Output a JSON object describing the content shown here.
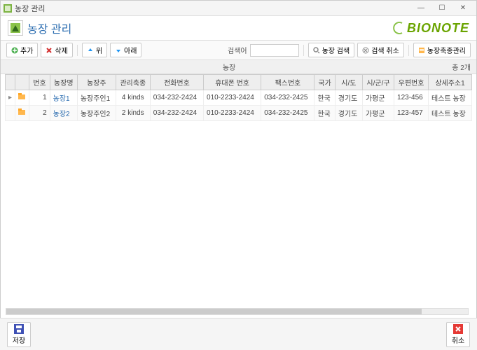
{
  "window": {
    "title": "농장 관리"
  },
  "header": {
    "title": "농장 관리",
    "brand": "BIONOTE"
  },
  "toolbar": {
    "add": "추가",
    "delete": "삭제",
    "up": "위",
    "down": "아래",
    "search_label": "검색어",
    "search_value": "",
    "farm_search": "농장 검색",
    "search_cancel": "검색 취소",
    "species_mgmt": "농장축종관리"
  },
  "section": {
    "title": "농장",
    "total": "총 2개"
  },
  "columns": [
    "번호",
    "농장명",
    "농장주",
    "관리축종",
    "전화번호",
    "휴대폰 번호",
    "팩스번호",
    "국가",
    "시/도",
    "시/군/구",
    "우편번호",
    "상세주소1"
  ],
  "rows": [
    {
      "no": "1",
      "name": "농장1",
      "owner": "농장주인1",
      "species": "4 kinds",
      "tel": "034-232-2424",
      "phone": "010-2233-2424",
      "fax": "034-232-2425",
      "country": "한국",
      "prov": "경기도",
      "city": "가평군",
      "zip": "123-456",
      "addr": "테스트 농장"
    },
    {
      "no": "2",
      "name": "농장2",
      "owner": "농장주인2",
      "species": "2 kinds",
      "tel": "034-232-2424",
      "phone": "010-2233-2424",
      "fax": "034-232-2425",
      "country": "한국",
      "prov": "경기도",
      "city": "가평군",
      "zip": "123-457",
      "addr": "테스트 농장"
    }
  ],
  "footer": {
    "save": "저장",
    "cancel": "취소"
  }
}
